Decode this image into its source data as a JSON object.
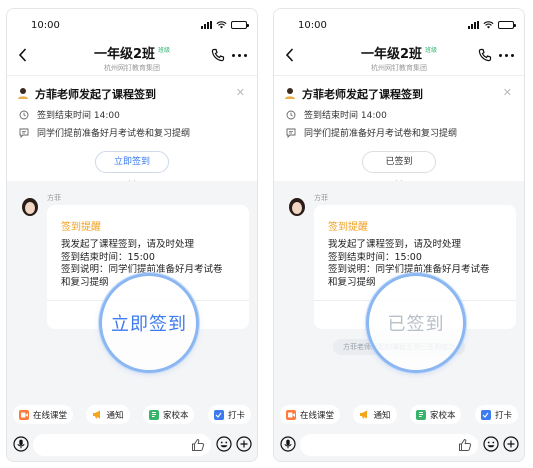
{
  "colors": {
    "accent_blue": "#3d7bf0",
    "title_orange": "#f0a020",
    "tag_green": "#2db36b",
    "page_bg": "#f4f5f7",
    "magnifier_ring": "#8ab6f2"
  },
  "phones": [
    {
      "status": {
        "time": "10:00"
      },
      "nav": {
        "title": "一年级2班",
        "tag": "班级",
        "subtitle": "杭州网钉教育集团"
      },
      "notice": {
        "title": "方菲老师发起了课程签到",
        "time_line": "签到结束时间 14:00",
        "desc_line": "同学们提前准备好月考试卷和复习提纲",
        "button_label": "立即签到"
      },
      "message": {
        "sender": "方菲",
        "title": "签到提醒",
        "body": [
          "我发起了课程签到，请及时处理",
          "签到结束时间：15:00",
          "签到说明：同学们提前准备好月考试卷",
          "和复习提纲"
        ]
      },
      "magnifier_label": "立即签到",
      "quick_actions": [
        {
          "label": "在线课堂",
          "icon": "video-classroom-icon"
        },
        {
          "label": "通知",
          "icon": "megaphone-icon"
        },
        {
          "label": "家校本",
          "icon": "notebook-icon"
        },
        {
          "label": "打卡",
          "icon": "checkin-icon"
        }
      ]
    },
    {
      "status": {
        "time": "10:00"
      },
      "nav": {
        "title": "一年级2班",
        "tag": "班级",
        "subtitle": "杭州网钉教育集团"
      },
      "notice": {
        "title": "方菲老师发起了课程签到",
        "time_line": "签到结束时间 14:00",
        "desc_line": "同学们提前准备好月考试卷和复习提纲",
        "button_label": "已签到"
      },
      "message": {
        "sender": "方菲",
        "title": "签到提醒",
        "body": [
          "我发起了课程签到，请及时处理",
          "签到结束时间：15:00",
          "签到说明：同学们提前准备好月考试卷",
          "和复习提纲"
        ]
      },
      "system_message": "方菲老师发起的课程签到已签到成功",
      "magnifier_label": "已签到",
      "quick_actions": [
        {
          "label": "在线课堂",
          "icon": "video-classroom-icon"
        },
        {
          "label": "通知",
          "icon": "megaphone-icon"
        },
        {
          "label": "家校本",
          "icon": "notebook-icon"
        },
        {
          "label": "打卡",
          "icon": "checkin-icon"
        }
      ]
    }
  ]
}
